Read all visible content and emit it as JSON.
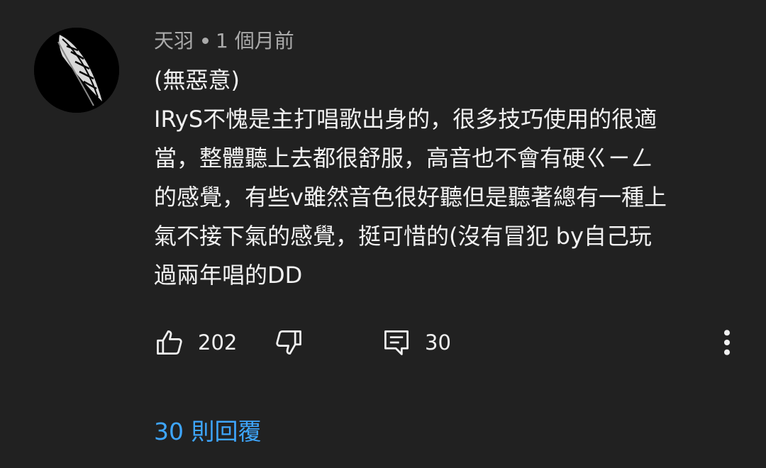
{
  "comment": {
    "author": "天羽",
    "time": "1 個月前",
    "lines": [
      "(無惡意)",
      "IRyS不愧是主打唱歌出身的，很多技巧使用的很適",
      "當，整體聽上去都很舒服，高音也不會有硬ㄍㄧㄥ",
      "的感覺，有些v雖然音色很好聽但是聽著總有一種上",
      "氣不接下氣的感覺，挺可惜的(沒有冒犯 by自己玩",
      "過兩年唱的DD"
    ],
    "likes": "202",
    "reply_count": "30",
    "replies_link": "30 則回覆"
  },
  "icons": {
    "like": "thumbs-up-icon",
    "dislike": "thumbs-down-icon",
    "reply": "comment-icon",
    "more": "more-vertical-icon"
  },
  "colors": {
    "background": "#212121",
    "text": "#f1f1f1",
    "meta": "#aaaaaa",
    "link": "#3ea6ff"
  }
}
